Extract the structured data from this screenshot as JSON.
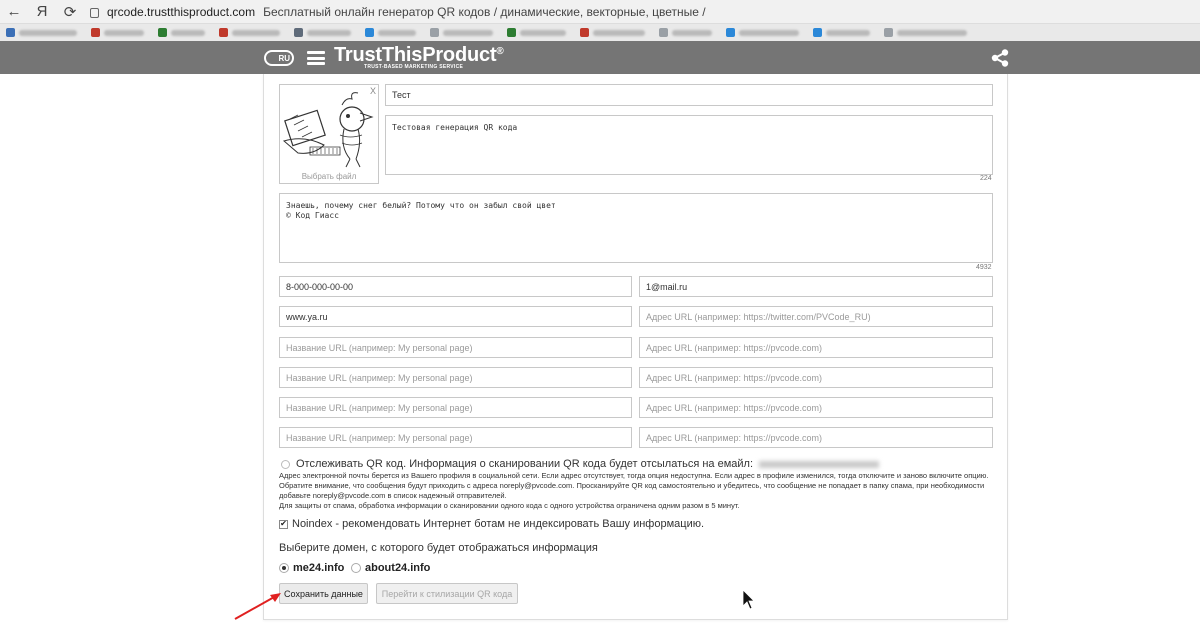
{
  "browser": {
    "back_icon": "arrow-left-icon",
    "yandex_label": "Я",
    "reload_icon": "reload-icon",
    "lock_icon": "lock-icon",
    "url_domain": "qrcode.trustthisproduct.com",
    "page_title": "Бесплатный онлайн генератор QR кодов / динамические, векторные, цветные /",
    "bookmark_colors": [
      "#3b6fb6",
      "#c0392b",
      "#2d7d32",
      "#c0392b",
      "#5f6b7a",
      "#2b88d8",
      "#9aa0a6",
      "#2d7d32",
      "#c0392b",
      "#9aa0a6",
      "#2b88d8",
      "#2b88d8",
      "#9aa0a6"
    ]
  },
  "header": {
    "globe_text": "RU",
    "brand": "TrustThisProduct",
    "brand_mark": "®",
    "tagline": "TRUST-BASED MARKETING SERVICE",
    "menu_icon": "hamburger-icon",
    "share_icon": "share-icon"
  },
  "form": {
    "image": {
      "close_label": "X",
      "choose_file": "Выбрать файл"
    },
    "name_value": "Тест",
    "description_value": "Тестовая генерация QR кода",
    "description_counter": "224",
    "text_value": "Знаешь, почему снег белый? Потому что он забыл свой цвет\n© Код Гиасс",
    "text_counter": "4932",
    "phone_value": "8-000-000-00-00",
    "email_value": "1@mail.ru",
    "website_value": "www.ya.ru",
    "social_placeholder": "Адрес URL (например: https://twitter.com/PVCode_RU)",
    "link_rows": [
      {
        "name_placeholder": "Название URL (например: My personal page)",
        "url_placeholder": "Адрес URL (например: https://pvcode.com)"
      },
      {
        "name_placeholder": "Название URL (например: My personal page)",
        "url_placeholder": "Адрес URL (например: https://pvcode.com)"
      },
      {
        "name_placeholder": "Название URL (например: My personal page)",
        "url_placeholder": "Адрес URL (например: https://pvcode.com)"
      },
      {
        "name_placeholder": "Название URL (например: My personal page)",
        "url_placeholder": "Адрес URL (например: https://pvcode.com)"
      }
    ],
    "tracking_label": "Отслеживать QR код. Информация о сканировании QR кода будет отсылаться на емайл:",
    "tracking_desc": "Адрес электронной почты берется из Вашего профиля в социальной сети. Если адрес отсутствует, тогда опция недоступна. Если адрес в профиле изменился, тогда отключите и заново включите опцию. Обратите внимание, что сообщения будут приходить с адреса noreply@pvcode.com. Просканируйте QR код самостоятельно и убедитесь, что сообщение не попадает в папку спама, при необходимости добавьте noreply@pvcode.com в список надежный отправителей.",
    "tracking_desc2": "Для защиты от спама, обработка информации о сканировании одного кода с одного устройства ограничена одним разом в 5 минут.",
    "noindex_label": "Noindex - рекомендовать Интернет ботам не индексировать Вашу информацию.",
    "noindex_checked": true,
    "domain_label": "Выберите домен, с которого будет отображаться информация",
    "domain_options": [
      "me24.info",
      "about24.info"
    ],
    "domain_selected": "me24.info",
    "save_button": "Сохранить данные",
    "styling_button": "Перейти к стилизации QR кода"
  },
  "colors": {
    "header_bg": "#757575",
    "annotation_arrow": "#e02020"
  }
}
